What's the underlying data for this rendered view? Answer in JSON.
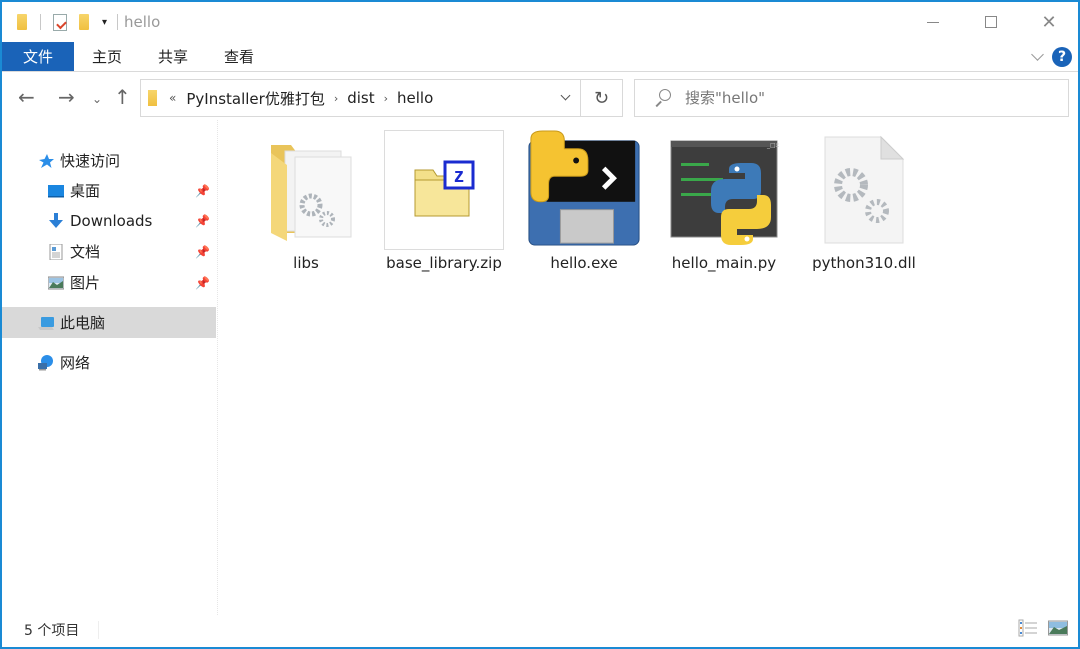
{
  "window": {
    "title": "hello",
    "controls": {
      "minimize": "minimize",
      "maximize": "maximize",
      "close": "✕"
    }
  },
  "quick_access_toolbar": {
    "icons": [
      "folder-icon",
      "properties-icon",
      "new-folder-icon"
    ],
    "dropdown": "▾"
  },
  "ribbon": {
    "tabs": [
      {
        "label": "文件",
        "active": true
      },
      {
        "label": "主页"
      },
      {
        "label": "共享"
      },
      {
        "label": "查看"
      }
    ],
    "help_label": "?"
  },
  "navigation": {
    "back": "←",
    "forward": "→",
    "recent": "⌄",
    "up": "↑",
    "address": {
      "overflow": "«",
      "breadcrumbs": [
        "PyInstaller优雅打包",
        "dist",
        "hello"
      ],
      "separator": "›"
    },
    "refresh": "↻",
    "search": {
      "placeholder": "搜索\"hello\"",
      "value": ""
    }
  },
  "sidebar": {
    "items": [
      {
        "label": "快速访问",
        "icon": "star-icon"
      },
      {
        "label": "桌面",
        "icon": "desktop-icon",
        "pinned": true
      },
      {
        "label": "Downloads",
        "icon": "download-icon",
        "pinned": true
      },
      {
        "label": "文档",
        "icon": "documents-icon",
        "pinned": true
      },
      {
        "label": "图片",
        "icon": "pictures-icon",
        "pinned": true
      },
      {
        "label": "此电脑",
        "icon": "computer-icon",
        "selected": true
      },
      {
        "label": "网络",
        "icon": "network-icon"
      }
    ]
  },
  "files": [
    {
      "name": "libs",
      "type": "folder"
    },
    {
      "name": "base_library.zip",
      "type": "zip"
    },
    {
      "name": "hello.exe",
      "type": "exe"
    },
    {
      "name": "hello_main.py",
      "type": "python"
    },
    {
      "name": "python310.dll",
      "type": "dll"
    }
  ],
  "status": {
    "item_count": "5 个项目"
  },
  "colors": {
    "accent": "#1a63b8",
    "window_border": "#1a8ad4",
    "selected_bg": "#d9d9d9"
  }
}
